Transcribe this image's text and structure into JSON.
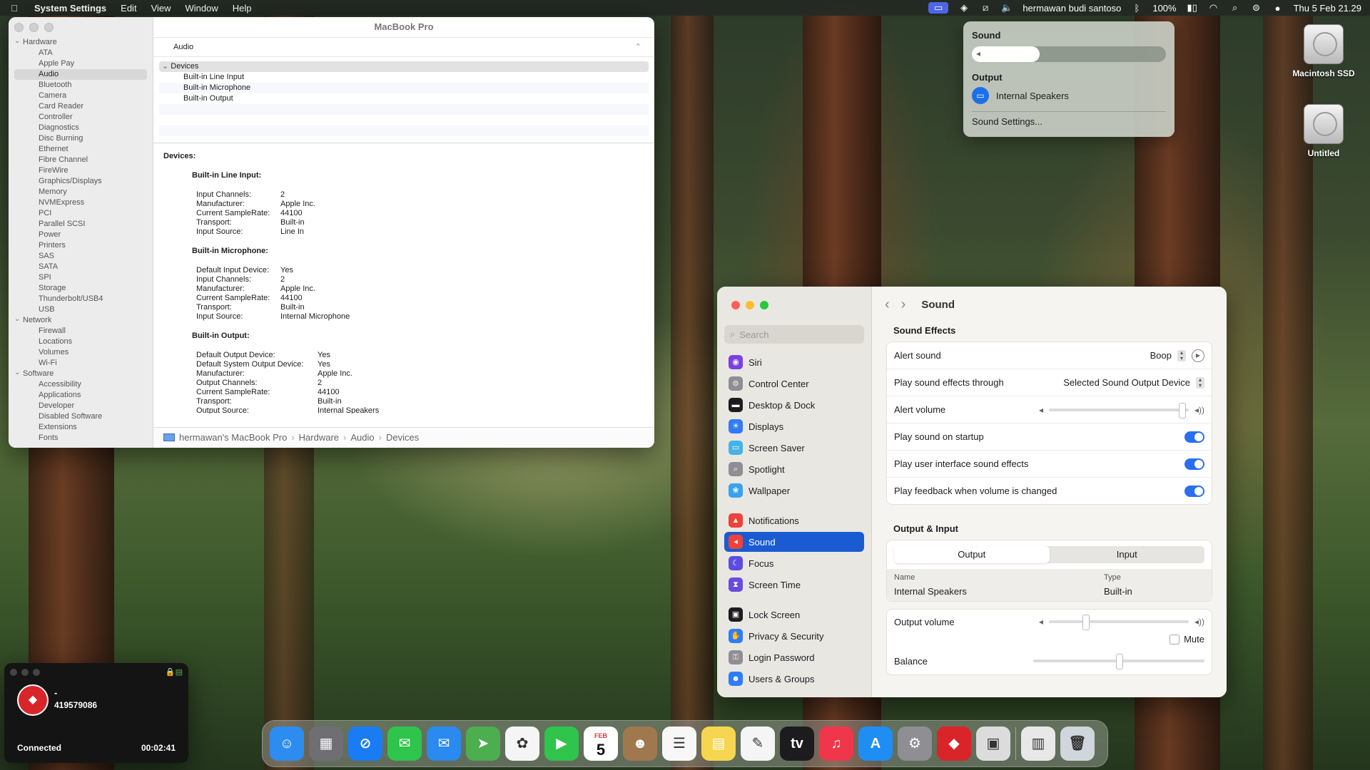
{
  "menubar": {
    "app_name": "System Settings",
    "menus": [
      "Edit",
      "View",
      "Window",
      "Help"
    ],
    "user": "hermawan budi santoso",
    "battery": "100%",
    "datetime": "Thu 5 Feb  21.29"
  },
  "sysinfo": {
    "title": "MacBook Pro",
    "section": "Audio",
    "sidebar": [
      {
        "group": "Hardware",
        "items": [
          "ATA",
          "Apple Pay",
          "Audio",
          "Bluetooth",
          "Camera",
          "Card Reader",
          "Controller",
          "Diagnostics",
          "Disc Burning",
          "Ethernet",
          "Fibre Channel",
          "FireWire",
          "Graphics/Displays",
          "Memory",
          "NVMExpress",
          "PCI",
          "Parallel SCSI",
          "Power",
          "Printers",
          "SAS",
          "SATA",
          "SPI",
          "Storage",
          "Thunderbolt/USB4",
          "USB"
        ]
      },
      {
        "group": "Network",
        "items": [
          "Firewall",
          "Locations",
          "Volumes",
          "Wi-Fi"
        ]
      },
      {
        "group": "Software",
        "items": [
          "Accessibility",
          "Applications",
          "Developer",
          "Disabled Software",
          "Extensions",
          "Fonts"
        ]
      }
    ],
    "selected_item": "Audio",
    "device_tree": {
      "header": "Devices",
      "children": [
        "Built-in Line Input",
        "Built-in Microphone",
        "Built-in Output"
      ]
    },
    "details_heading": "Devices:",
    "devices": [
      {
        "name": "Built-in Line Input:",
        "props": [
          [
            "Input Channels:",
            "2"
          ],
          [
            "Manufacturer:",
            "Apple Inc."
          ],
          [
            "Current SampleRate:",
            "44100"
          ],
          [
            "Transport:",
            "Built-in"
          ],
          [
            "Input Source:",
            "Line In"
          ]
        ]
      },
      {
        "name": "Built-in Microphone:",
        "props": [
          [
            "Default Input Device:",
            "Yes"
          ],
          [
            "Input Channels:",
            "2"
          ],
          [
            "Manufacturer:",
            "Apple Inc."
          ],
          [
            "Current SampleRate:",
            "44100"
          ],
          [
            "Transport:",
            "Built-in"
          ],
          [
            "Input Source:",
            "Internal Microphone"
          ]
        ]
      },
      {
        "name": "Built-in Output:",
        "props": [
          [
            "Default Output Device:",
            "Yes"
          ],
          [
            "Default System Output Device:",
            "Yes"
          ],
          [
            "Manufacturer:",
            "Apple Inc."
          ],
          [
            "Output Channels:",
            "2"
          ],
          [
            "Current SampleRate:",
            "44100"
          ],
          [
            "Transport:",
            "Built-in"
          ],
          [
            "Output Source:",
            "Internal Speakers"
          ]
        ]
      }
    ],
    "breadcrumb": [
      "hermawan's MacBook Pro",
      "Hardware",
      "Audio",
      "Devices"
    ]
  },
  "sound_menu": {
    "title": "Sound",
    "volume_fraction": 0.35,
    "output_label": "Output",
    "output_device": "Internal Speakers",
    "settings_link": "Sound Settings..."
  },
  "desktop_icons": [
    "Macintosh SSD",
    "Untitled"
  ],
  "settings": {
    "search_placeholder": "Search",
    "nav": [
      {
        "label": "Siri",
        "color": "#7b3fe4",
        "icon": "siri-icon"
      },
      {
        "label": "Control Center",
        "color": "#8e8e93",
        "icon": "control-center-icon"
      },
      {
        "label": "Desktop & Dock",
        "color": "#1c1c1e",
        "icon": "dock-icon"
      },
      {
        "label": "Displays",
        "color": "#2f7cf6",
        "icon": "display-icon"
      },
      {
        "label": "Screen Saver",
        "color": "#46b3e6",
        "icon": "screen-saver-icon"
      },
      {
        "label": "Spotlight",
        "color": "#8e8e93",
        "icon": "spotlight-icon"
      },
      {
        "label": "Wallpaper",
        "color": "#3aa0f0",
        "icon": "wallpaper-icon"
      },
      {
        "label": "Notifications",
        "color": "#f0413a",
        "icon": "bell-icon"
      },
      {
        "label": "Sound",
        "color": "#f0413a",
        "icon": "speaker-icon"
      },
      {
        "label": "Focus",
        "color": "#5e4be0",
        "icon": "moon-icon"
      },
      {
        "label": "Screen Time",
        "color": "#6a4be0",
        "icon": "hourglass-icon"
      },
      {
        "label": "Lock Screen",
        "color": "#1c1c1e",
        "icon": "lock-icon"
      },
      {
        "label": "Privacy & Security",
        "color": "#2f7cf6",
        "icon": "hand-icon"
      },
      {
        "label": "Login Password",
        "color": "#8e8e93",
        "icon": "key-icon"
      },
      {
        "label": "Users & Groups",
        "color": "#2f7cf6",
        "icon": "users-icon"
      }
    ],
    "selected_nav": "Sound",
    "pane_title": "Sound",
    "sound_effects": {
      "heading": "Sound Effects",
      "alert_sound_label": "Alert sound",
      "alert_sound_value": "Boop",
      "play_through_label": "Play sound effects through",
      "play_through_value": "Selected Sound Output Device",
      "alert_volume_label": "Alert volume",
      "alert_volume_fraction": 0.97,
      "toggles": [
        {
          "label": "Play sound on startup",
          "on": true
        },
        {
          "label": "Play user interface sound effects",
          "on": true
        },
        {
          "label": "Play feedback when volume is changed",
          "on": true
        }
      ]
    },
    "output_input": {
      "heading": "Output & Input",
      "tabs": [
        "Output",
        "Input"
      ],
      "active_tab": "Output",
      "columns": [
        "Name",
        "Type"
      ],
      "rows": [
        [
          "Internal Speakers",
          "Built-in"
        ]
      ],
      "output_volume_label": "Output volume",
      "output_volume_fraction": 0.25,
      "mute_label": "Mute",
      "balance_label": "Balance",
      "balance_fraction": 0.5
    }
  },
  "call": {
    "name": "-",
    "number": "419579086",
    "status": "Connected",
    "duration": "00:02:41"
  },
  "dock": [
    {
      "name": "finder",
      "color": "#2d8cf0",
      "glyph": "☺"
    },
    {
      "name": "launchpad",
      "color": "#6e6e73",
      "glyph": "▦"
    },
    {
      "name": "safari",
      "color": "#1a7cf5",
      "glyph": "⊘"
    },
    {
      "name": "messages",
      "color": "#2fc44b",
      "glyph": "✉"
    },
    {
      "name": "mail",
      "color": "#2a8af0",
      "glyph": "✉"
    },
    {
      "name": "maps",
      "color": "#4cae4f",
      "glyph": "➤"
    },
    {
      "name": "photos",
      "color": "#f5f5f5",
      "glyph": "✿"
    },
    {
      "name": "facetime",
      "color": "#2fc44b",
      "glyph": "▶"
    },
    {
      "name": "calendar",
      "color": "#ffffff",
      "glyph": ""
    },
    {
      "name": "contacts",
      "color": "#a0784e",
      "glyph": "☻"
    },
    {
      "name": "reminders",
      "color": "#f7f7f7",
      "glyph": "☰"
    },
    {
      "name": "notes",
      "color": "#f6d650",
      "glyph": "▤"
    },
    {
      "name": "freeform",
      "color": "#f5f5f5",
      "glyph": "✎"
    },
    {
      "name": "tv",
      "color": "#1c1c1e",
      "glyph": "tv"
    },
    {
      "name": "music",
      "color": "#f0364b",
      "glyph": "♫"
    },
    {
      "name": "app-store",
      "color": "#1e8ef5",
      "glyph": "A"
    },
    {
      "name": "system-settings",
      "color": "#8e8e93",
      "glyph": "⚙"
    },
    {
      "name": "call-app",
      "color": "#d9252a",
      "glyph": "◆"
    },
    {
      "name": "system-information",
      "color": "#dcdcdc",
      "glyph": "▣"
    },
    {
      "name": "separator",
      "color": "",
      "glyph": ""
    },
    {
      "name": "downloads",
      "color": "#e8e8e8",
      "glyph": "▥"
    },
    {
      "name": "trash",
      "color": "#d0d6dc",
      "glyph": "🗑"
    }
  ],
  "calendar_icon": {
    "month": "FEB",
    "day": "5"
  }
}
